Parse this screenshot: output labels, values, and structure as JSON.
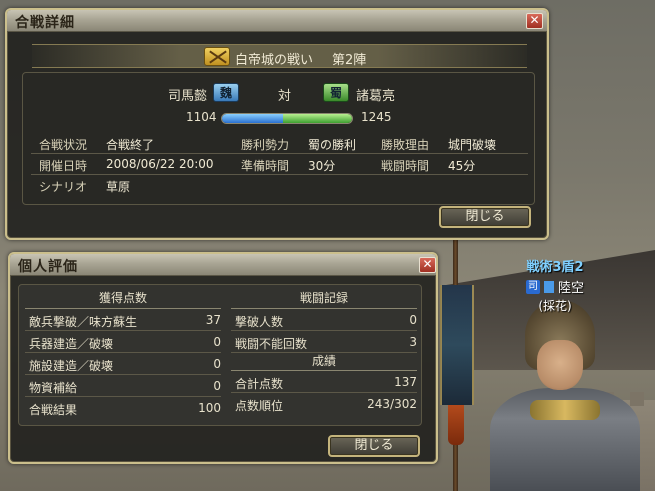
{
  "character": {
    "title": "戦術3盾2",
    "badge": "司",
    "name": "陸空",
    "team": "(採花)"
  },
  "battle_window": {
    "title": "合戦詳細",
    "close_label": "✕",
    "battle_name": "白帝城の戦い",
    "stage": "第2陣",
    "left_commander": "司馬懿",
    "left_faction": "魏",
    "vs": "対",
    "right_faction": "蜀",
    "right_commander": "諸葛亮",
    "left_score": "1104",
    "right_score": "1245",
    "score_share_left": 0.47,
    "info": [
      {
        "label": "合戦状況",
        "value": "合戦終了"
      },
      {
        "label": "勝利勢力",
        "value": "蜀の勝利"
      },
      {
        "label": "勝敗理由",
        "value": "城門破壊"
      },
      {
        "label": "開催日時",
        "value": "2008/06/22 20:00"
      },
      {
        "label": "準備時間",
        "value": "30分"
      },
      {
        "label": "戦闘時間",
        "value": "45分"
      },
      {
        "label": "シナリオ",
        "value": "草原"
      }
    ],
    "close_button": "閉じる"
  },
  "personal_window": {
    "title": "個人評価",
    "close_label": "✕",
    "points_header": "獲得点数",
    "points": [
      {
        "label": "敵兵撃破／味方蘇生",
        "value": "37"
      },
      {
        "label": "兵器建造／破壊",
        "value": "0"
      },
      {
        "label": "施設建造／破壊",
        "value": "0"
      },
      {
        "label": "物資補給",
        "value": "0"
      },
      {
        "label": "合戦結果",
        "value": "100"
      }
    ],
    "record_header": "戦闘記録",
    "record": [
      {
        "label": "撃破人数",
        "value": "0"
      },
      {
        "label": "戦闘不能回数",
        "value": "3"
      }
    ],
    "result_header": "成績",
    "result": [
      {
        "label": "合計点数",
        "value": "137"
      },
      {
        "label": "点数順位",
        "value": "243/302"
      }
    ],
    "close_button": "閉じる"
  },
  "colors": {
    "frame": "#cbbf8c",
    "wei": "#2a70d0",
    "shu": "#3ea030",
    "close": "#a03022"
  }
}
